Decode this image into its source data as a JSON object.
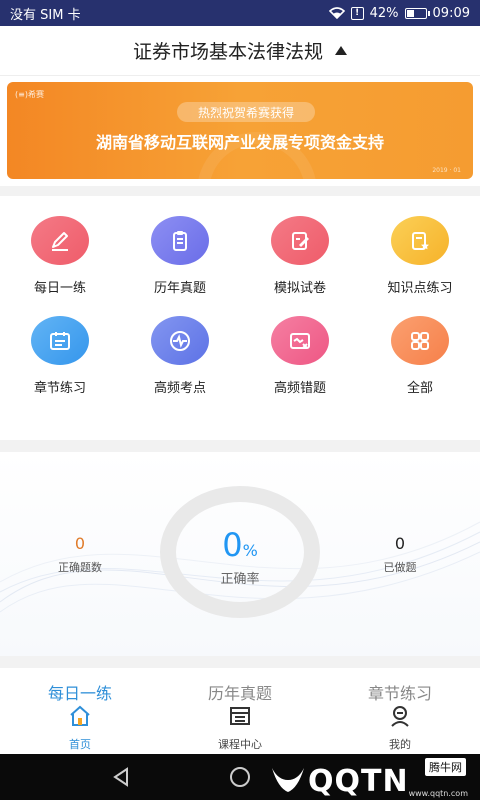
{
  "status_bar": {
    "carrier": "没有 SIM 卡",
    "battery": "42%",
    "battery_level": 0.42,
    "time": "09:09"
  },
  "header": {
    "title": "证券市场基本法律法规"
  },
  "banner": {
    "logo_text": "(≡)希赛",
    "pill": "热烈祝贺希赛获得",
    "headline": "湖南省移动互联网产业发展专项资金支持",
    "corner": "2019 · 01"
  },
  "grid": {
    "items": [
      {
        "label": "每日一练",
        "icon": "pencil-icon",
        "color": "#f26b78"
      },
      {
        "label": "历年真题",
        "icon": "clipboard-icon",
        "color": "#7b7cf0"
      },
      {
        "label": "模拟试卷",
        "icon": "edit-paper-icon",
        "color": "#f26b78"
      },
      {
        "label": "知识点练习",
        "icon": "star-doc-icon",
        "color": "#f9c23c"
      },
      {
        "label": "章节练习",
        "icon": "calendar-list-icon",
        "color": "#4aa5f0"
      },
      {
        "label": "高频考点",
        "icon": "pulse-icon",
        "color": "#6f82ec"
      },
      {
        "label": "高频错题",
        "icon": "error-card-icon",
        "color": "#f26b95"
      },
      {
        "label": "全部",
        "icon": "grid-icon",
        "color": "#f9905a"
      }
    ]
  },
  "stats": {
    "correct_count": {
      "value": "0",
      "label": "正确题数"
    },
    "accuracy": {
      "value": "0",
      "unit": "%",
      "label": "正确率"
    },
    "done_count": {
      "value": "0",
      "label": "已做题"
    }
  },
  "bottom_nav": {
    "items": [
      {
        "top": "每日一练",
        "label": "首页",
        "icon": "home-icon"
      },
      {
        "top": "历年真题",
        "label": "课程中心",
        "icon": "course-icon"
      },
      {
        "top": "章节练习",
        "label": "我的",
        "icon": "profile-icon"
      }
    ]
  },
  "watermark": {
    "text": "QQTN",
    "tag": "腾牛网",
    "url": "www.qqtn.com"
  }
}
